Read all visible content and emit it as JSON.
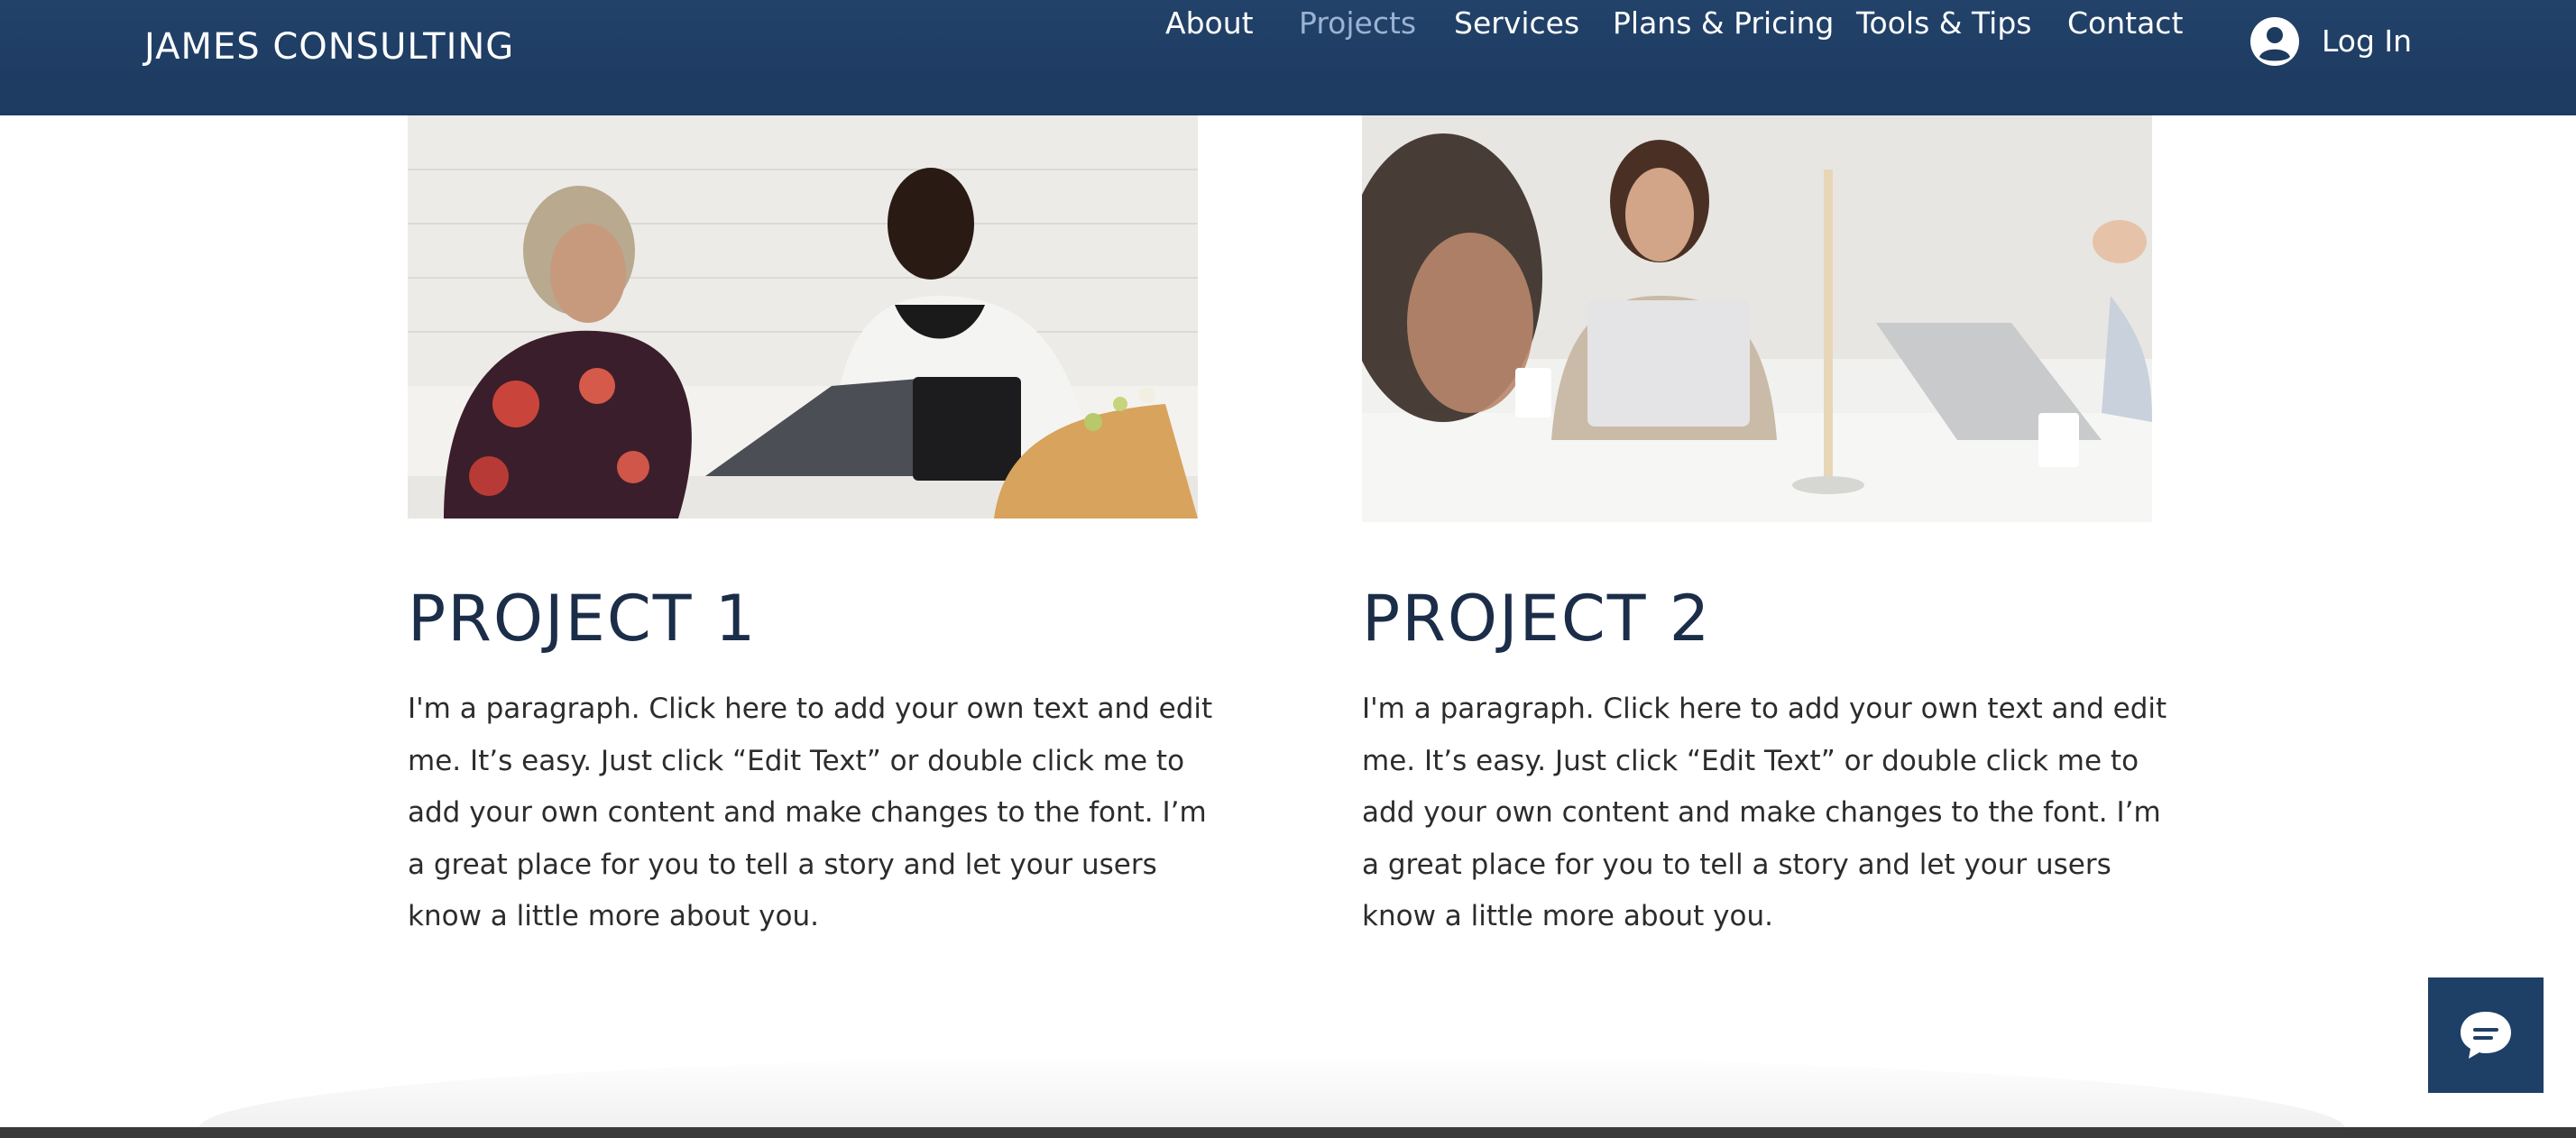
{
  "header": {
    "brand": "JAMES CONSULTING",
    "nav": [
      {
        "label": "About",
        "active": false
      },
      {
        "label": "Projects",
        "active": true
      },
      {
        "label": "Services",
        "active": false
      },
      {
        "label": "Plans & Pricing",
        "active": false
      },
      {
        "label": "Tools & Tips",
        "active": false
      },
      {
        "label": "Contact",
        "active": false
      }
    ],
    "login_label": "Log In",
    "login_icon": "user-avatar-icon"
  },
  "projects": [
    {
      "title": "PROJECT 1",
      "text": "I'm a paragraph. Click here to add your own text and edit me. It’s easy. Just click “Edit Text” or double click me to add your own content and make changes to the font. I’m a great place for you to tell a story and let your users know a little more about you.",
      "image": "two-women-meeting-photo"
    },
    {
      "title": "PROJECT 2",
      "text": "I'm a paragraph. Click here to add your own text and edit me. It’s easy. Just click “Edit Text” or double click me to add your own content and make changes to the font. I’m a great place for you to tell a story and let your users know a little more about you.",
      "image": "office-laptop-meeting-photo"
    }
  ],
  "chat": {
    "icon": "chat-bubble-icon"
  },
  "colors": {
    "header_bg": "#1d3a5f",
    "nav_active": "#9ab3d3",
    "title": "#1b2d48",
    "chat_bg": "#1e3f66"
  }
}
